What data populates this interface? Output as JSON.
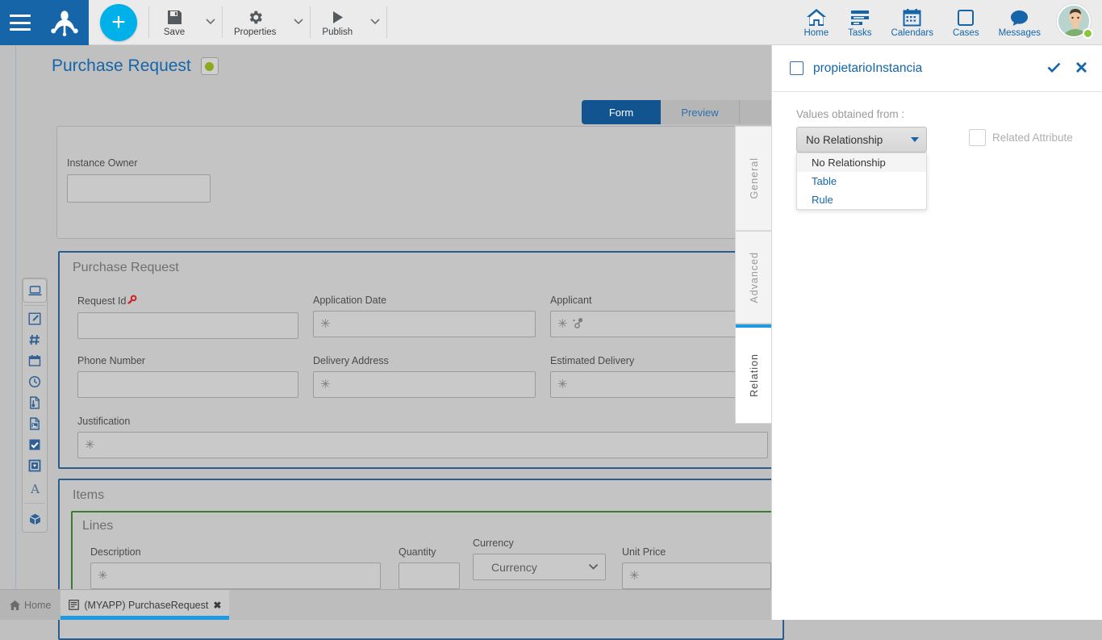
{
  "topbar": {
    "menu_icon": "hamburger-icon",
    "logo_icon": "bizagi-frog-logo",
    "add_label": "+",
    "tools": [
      {
        "label": "Save",
        "icon": "save-icon"
      },
      {
        "label": "Properties",
        "icon": "gear-icon"
      },
      {
        "label": "Publish",
        "icon": "play-icon"
      }
    ],
    "nav": [
      {
        "label": "Home",
        "icon": "home-icon"
      },
      {
        "label": "Tasks",
        "icon": "tasks-icon"
      },
      {
        "label": "Calendars",
        "icon": "calendar-icon"
      },
      {
        "label": "Cases",
        "icon": "case-square-icon"
      },
      {
        "label": "Messages",
        "icon": "message-bubble-icon"
      }
    ],
    "avatar_icon": "user-avatar",
    "presence": "online",
    "colors": {
      "brand_blue": "#1565a8",
      "accent_cyan": "#00b0e8",
      "presence_green": "#8cc63f"
    }
  },
  "page": {
    "title": "Purchase Request",
    "status_color": "#8aab1f",
    "view_tabs": [
      {
        "label": "Form",
        "active": true
      },
      {
        "label": "Preview",
        "active": false
      },
      {
        "label": "",
        "active": false
      }
    ]
  },
  "owner_panel": {
    "field_label": "Instance Owner",
    "field_value": ""
  },
  "pr_group": {
    "title": "Purchase Request",
    "fields": [
      {
        "label": "Request Id",
        "value": "",
        "icon": "key-icon",
        "required": false
      },
      {
        "label": "Application Date",
        "value": "",
        "icon": "",
        "required": true
      },
      {
        "label": "Applicant",
        "value": "",
        "icon": "relation-icon",
        "required": true
      },
      {
        "label": "Phone Number",
        "value": "",
        "icon": "",
        "required": false
      },
      {
        "label": "Delivery Address",
        "value": "",
        "icon": "",
        "required": true
      },
      {
        "label": "Estimated Delivery",
        "value": "",
        "icon": "",
        "required": true
      },
      {
        "label": "Justification",
        "value": "",
        "icon": "",
        "required": true
      }
    ]
  },
  "items_group": {
    "title": "Items",
    "lines_title": "Lines",
    "columns": [
      {
        "label": "Description",
        "value": "",
        "required": true,
        "type": "text"
      },
      {
        "label": "Quantity",
        "value": "",
        "required": false,
        "type": "text"
      },
      {
        "label": "Currency",
        "value": "Currency",
        "required": false,
        "type": "select"
      },
      {
        "label": "Unit Price",
        "value": "",
        "required": true,
        "type": "text"
      }
    ]
  },
  "vertical_tabs": [
    {
      "label": "General",
      "active": false
    },
    {
      "label": "Advanced",
      "active": false
    },
    {
      "label": "Relation",
      "active": true
    }
  ],
  "rail": {
    "items": [
      {
        "icon": "display-control-icon",
        "selected": true
      },
      {
        "icon": "edit-textbox-icon",
        "selected": false
      },
      {
        "icon": "number-hash-icon",
        "selected": false
      },
      {
        "icon": "date-calendar-icon",
        "selected": false
      },
      {
        "icon": "time-clock-icon",
        "selected": false
      },
      {
        "icon": "file-upload-icon",
        "selected": false
      },
      {
        "icon": "image-file-icon",
        "selected": false
      },
      {
        "icon": "checkbox-checked-icon",
        "selected": false
      },
      {
        "icon": "combobox-icon",
        "selected": false
      },
      {
        "icon": "text-letter-a-icon",
        "selected": false
      },
      {
        "icon": "box-3d-icon",
        "selected": false
      }
    ]
  },
  "taskbar": {
    "home_label": "Home",
    "home_icon": "home-icon",
    "tabs": [
      {
        "label": "(MYAPP) PurchaseRequest",
        "icon": "form-doc-icon",
        "active": true,
        "close_icon": "close-icon"
      }
    ]
  },
  "property_panel": {
    "title": "propietarioInstancia",
    "checkbox_checked": false,
    "confirm_icon": "check-icon",
    "close_icon": "close-icon",
    "values_from_label": "Values obtained from :",
    "select": {
      "value": "No Relationship",
      "open": true,
      "options": [
        {
          "label": "No Relationship",
          "selected": true
        },
        {
          "label": "Table",
          "selected": false
        },
        {
          "label": "Rule",
          "selected": false
        }
      ]
    },
    "related_attribute": {
      "label": "Related Attribute",
      "checked": false,
      "enabled": false
    }
  }
}
